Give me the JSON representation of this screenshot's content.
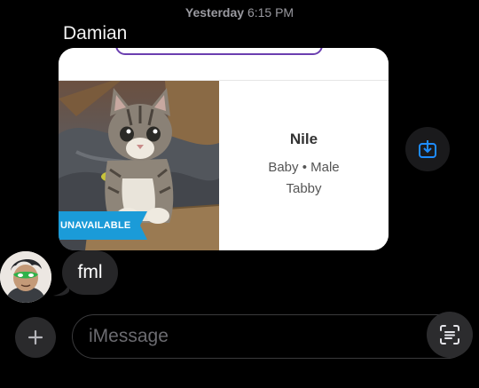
{
  "timestamp": {
    "day": "Yesterday",
    "time": "6:15 PM"
  },
  "sender": "Damian",
  "card": {
    "name": "Nile",
    "age": "Baby",
    "separator": "•",
    "sex": "Male",
    "breed": "Tabby",
    "status_badge": "UNAVAILABLE"
  },
  "reply": {
    "text": "fml"
  },
  "composer": {
    "placeholder": "iMessage"
  },
  "icons": {
    "save": "download-to-share-icon",
    "add": "plus-icon",
    "scan": "text-scan-icon"
  },
  "colors": {
    "accent_blue": "#1e8cff",
    "badge_blue": "#1b9bd8",
    "pill_purple": "#6b3fb0",
    "bubble_gray": "#262628"
  }
}
